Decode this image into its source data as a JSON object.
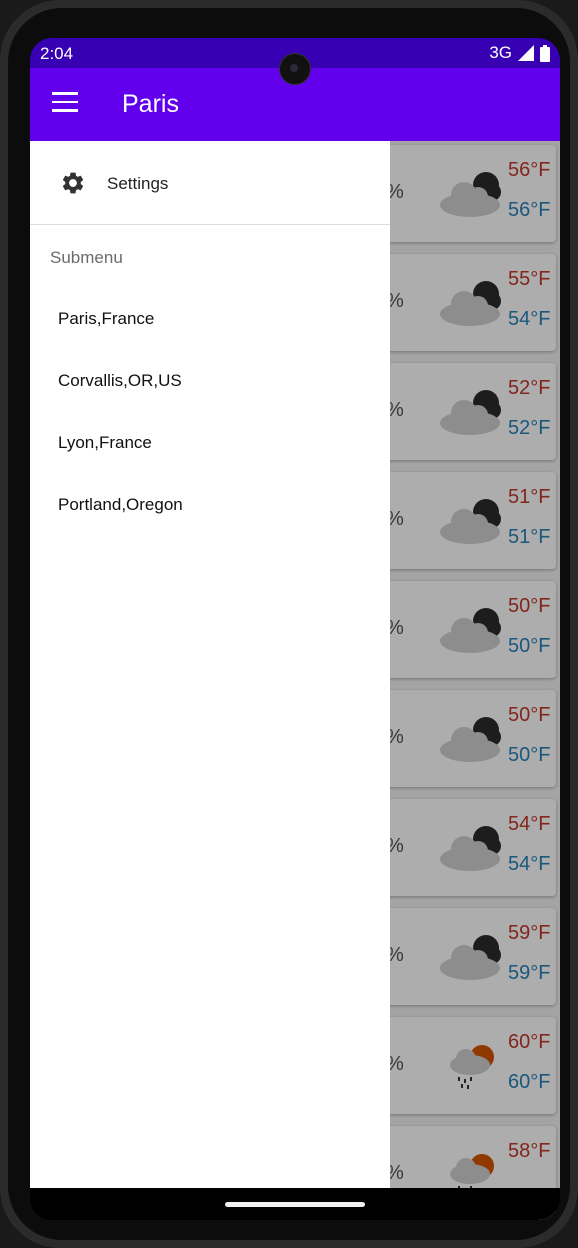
{
  "status_bar": {
    "time": "2:04",
    "network": "3G",
    "icons": [
      "signal-icon",
      "battery-icon"
    ]
  },
  "app_bar": {
    "title": "Paris",
    "menu_icon": "hamburger-menu-icon"
  },
  "drawer": {
    "settings": {
      "label": "Settings",
      "icon": "gear-icon"
    },
    "submenu_header": "Submenu",
    "items": [
      {
        "label": "Paris,France"
      },
      {
        "label": "Corvallis,OR,US"
      },
      {
        "label": "Lyon,France"
      },
      {
        "label": "Portland,Oregon"
      }
    ]
  },
  "forecast": [
    {
      "pct": "%",
      "icon": "cloud-moon-icon",
      "high": "56°F",
      "low": "56°F"
    },
    {
      "pct": "%",
      "icon": "cloud-moon-icon",
      "high": "55°F",
      "low": "54°F"
    },
    {
      "pct": "%",
      "icon": "cloud-moon-icon",
      "high": "52°F",
      "low": "52°F"
    },
    {
      "pct": "%",
      "icon": "cloud-moon-icon",
      "high": "51°F",
      "low": "51°F"
    },
    {
      "pct": "%",
      "icon": "cloud-moon-icon",
      "high": "50°F",
      "low": "50°F"
    },
    {
      "pct": "%",
      "icon": "cloud-moon-icon",
      "high": "50°F",
      "low": "50°F"
    },
    {
      "pct": "%",
      "icon": "cloud-moon-icon",
      "high": "54°F",
      "low": "54°F"
    },
    {
      "pct": "%",
      "icon": "cloud-moon-icon",
      "high": "59°F",
      "low": "59°F"
    },
    {
      "pct": "%",
      "icon": "rain-sun-icon",
      "high": "60°F",
      "low": "60°F"
    },
    {
      "pct": "%",
      "icon": "rain-sun-icon",
      "high": "58°F",
      "low": ""
    }
  ],
  "colors": {
    "status_bar": "#3700b3",
    "app_bar": "#6200ee",
    "high_temp": "#c0392b",
    "low_temp": "#2a80b9"
  }
}
